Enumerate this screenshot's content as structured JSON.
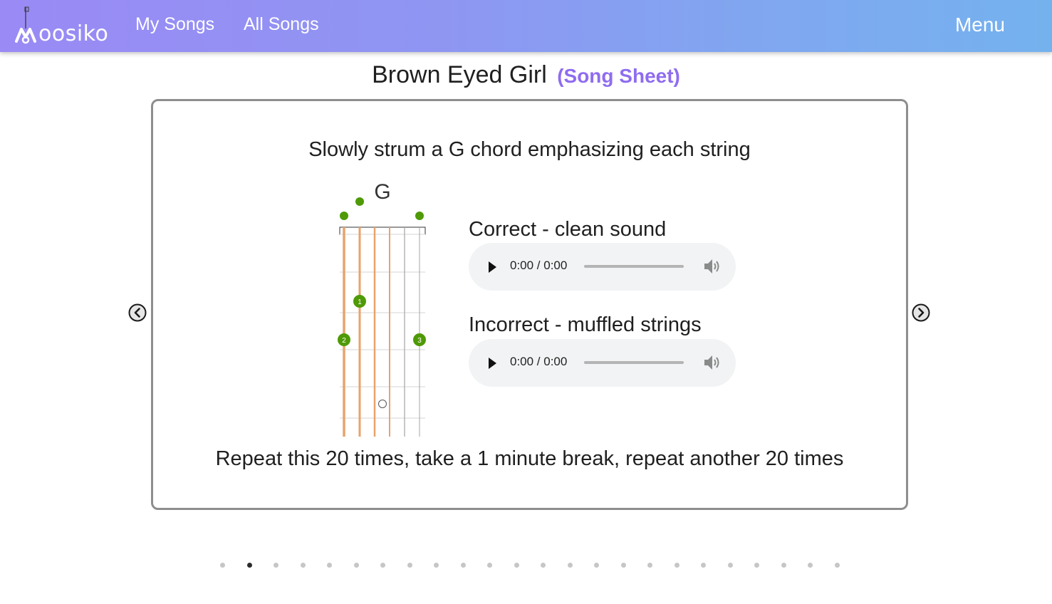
{
  "nav": {
    "logo_text": "oosiko",
    "my_songs": "My Songs",
    "all_songs": "All Songs",
    "menu": "Menu"
  },
  "title": {
    "song": "Brown Eyed Girl",
    "sheet_link": "(Song Sheet)"
  },
  "slide": {
    "instruction": "Slowly strum a G chord emphasizing each string",
    "chord": {
      "name": "G",
      "fingers": [
        "1",
        "2",
        "3"
      ]
    },
    "samples": [
      {
        "label": "Correct - clean sound",
        "time": "0:00 / 0:00"
      },
      {
        "label": "Incorrect - muffled strings",
        "time": "0:00 / 0:00"
      }
    ],
    "repeat": "Repeat this 20 times, take a 1 minute break, repeat another 20 times"
  },
  "pagination": {
    "total": 24,
    "active": 2
  },
  "colors": {
    "accent": "#8f6cf0",
    "finger_dot": "#4f9a07",
    "string_highlight": "#e8a36b"
  }
}
